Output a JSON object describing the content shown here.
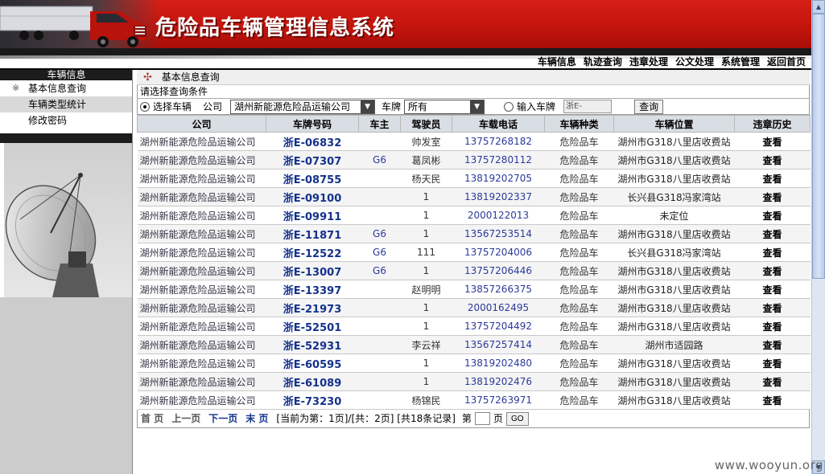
{
  "header": {
    "title": "危险品车辆管理信息系统"
  },
  "topnav": [
    "车辆信息",
    "轨迹查询",
    "违章处理",
    "公文处理",
    "系统管理",
    "返回首页"
  ],
  "sidebar": {
    "section_title": "车辆信息",
    "items": [
      {
        "label": "基本信息查询",
        "mark": "※"
      },
      {
        "label": "车辆类型统计"
      },
      {
        "label": "修改密码"
      }
    ]
  },
  "breadcrumb": {
    "icon": "move-icon",
    "label": "基本信息查询"
  },
  "filter": {
    "title": "请选择查询条件",
    "select_vehicle_label": "选择车辆",
    "company_label": "公司",
    "company_value": "湖州新能源危险品运输公司",
    "plate_label": "车牌",
    "plate_select_value": "所有",
    "input_plate_label": "输入车牌",
    "plate_input_value": "浙E-",
    "query_button": "查询"
  },
  "table": {
    "columns": [
      "公司",
      "车牌号码",
      "车主",
      "驾驶员",
      "车载电话",
      "车辆种类",
      "车辆位置",
      "违章历史"
    ],
    "rows": [
      [
        "湖州新能源危险品运输公司",
        "浙E-06832",
        "",
        "帅发室",
        "13757268182",
        "危险品车",
        "湖州市G318八里店收费站",
        "查看"
      ],
      [
        "湖州新能源危险品运输公司",
        "浙E-07307",
        "G6",
        "葛凤彬",
        "13757280112",
        "危险品车",
        "湖州市G318八里店收费站",
        "查看"
      ],
      [
        "湖州新能源危险品运输公司",
        "浙E-08755",
        "",
        "杨天民",
        "13819202705",
        "危险品车",
        "湖州市G318八里店收费站",
        "查看"
      ],
      [
        "湖州新能源危险品运输公司",
        "浙E-09100",
        "",
        "1",
        "13819202337",
        "危险品车",
        "长兴县G318冯家湾站",
        "查看"
      ],
      [
        "湖州新能源危险品运输公司",
        "浙E-09911",
        "",
        "1",
        "2000122013",
        "危险品车",
        "未定位",
        "查看"
      ],
      [
        "湖州新能源危险品运输公司",
        "浙E-11871",
        "G6",
        "1",
        "13567253514",
        "危险品车",
        "湖州市G318八里店收费站",
        "查看"
      ],
      [
        "湖州新能源危险品运输公司",
        "浙E-12522",
        "G6",
        "111",
        "13757204006",
        "危险品车",
        "长兴县G318冯家湾站",
        "查看"
      ],
      [
        "湖州新能源危险品运输公司",
        "浙E-13007",
        "G6",
        "1",
        "13757206446",
        "危险品车",
        "湖州市G318八里店收费站",
        "查看"
      ],
      [
        "湖州新能源危险品运输公司",
        "浙E-13397",
        "",
        "赵明明",
        "13857266375",
        "危险品车",
        "湖州市G318八里店收费站",
        "查看"
      ],
      [
        "湖州新能源危险品运输公司",
        "浙E-21973",
        "",
        "1",
        "2000162495",
        "危险品车",
        "湖州市G318八里店收费站",
        "查看"
      ],
      [
        "湖州新能源危险品运输公司",
        "浙E-52501",
        "",
        "1",
        "13757204492",
        "危险品车",
        "湖州市G318八里店收费站",
        "查看"
      ],
      [
        "湖州新能源危险品运输公司",
        "浙E-52931",
        "",
        "李云祥",
        "13567257414",
        "危险品车",
        "湖州市适园路",
        "查看"
      ],
      [
        "湖州新能源危险品运输公司",
        "浙E-60595",
        "",
        "1",
        "13819202480",
        "危险品车",
        "湖州市G318八里店收费站",
        "查看"
      ],
      [
        "湖州新能源危险品运输公司",
        "浙E-61089",
        "",
        "1",
        "13819202476",
        "危险品车",
        "湖州市G318八里店收费站",
        "查看"
      ],
      [
        "湖州新能源危险品运输公司",
        "浙E-73230",
        "",
        "杨锦民",
        "13757263971",
        "危险品车",
        "湖州市G318八里店收费站",
        "查看"
      ]
    ]
  },
  "pager": {
    "first": "首 页",
    "prev": "上一页",
    "next": "下一页",
    "last": "末 页",
    "status": "[当前为第：1页]/[共：2页] [共18条记录]",
    "goto_prefix": "第",
    "goto_suffix": "页",
    "go_button": "GO"
  },
  "watermark": "www.wooyun.org",
  "colors": {
    "banner_red": "#c4150d",
    "link_blue": "#14328c",
    "header_bg": "#d9dde4"
  }
}
